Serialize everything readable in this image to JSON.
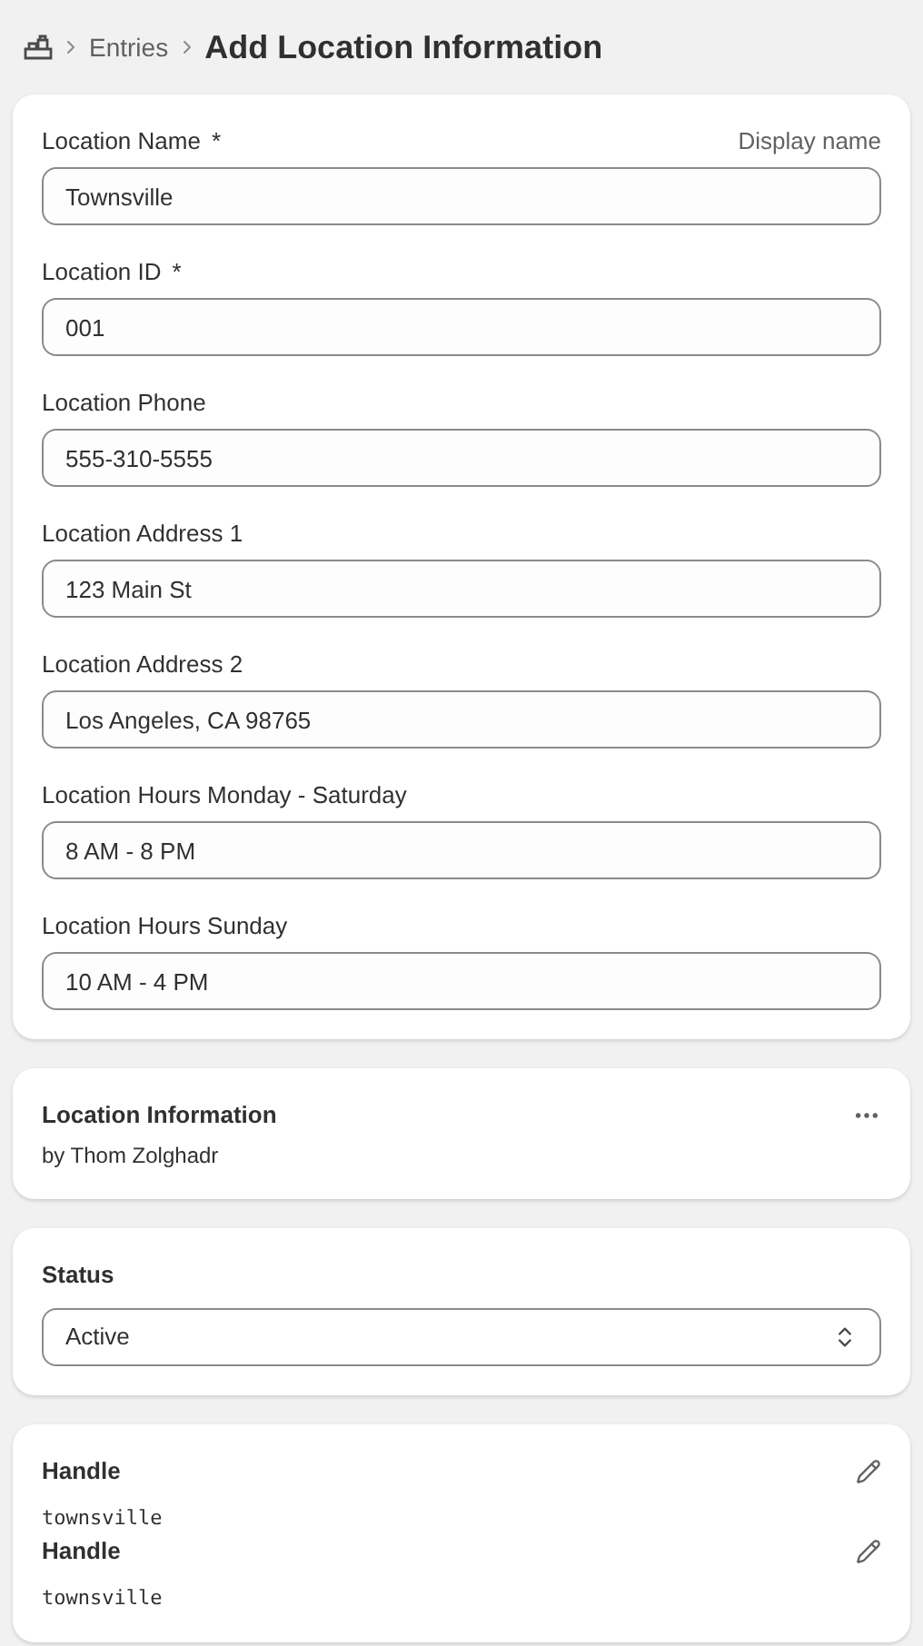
{
  "breadcrumb": {
    "items": [
      "Entries"
    ],
    "title": "Add Location Information"
  },
  "fields": [
    {
      "label": "Location Name",
      "required_mark": "*",
      "hint": "Display name",
      "value": "Townsville"
    },
    {
      "label": "Location ID",
      "required_mark": "*",
      "value": "001"
    },
    {
      "label": "Location Phone",
      "value": "555-310-5555"
    },
    {
      "label": "Location Address 1",
      "value": "123 Main St"
    },
    {
      "label": "Location Address 2",
      "value": "Los Angeles, CA 98765"
    },
    {
      "label": "Location Hours Monday - Saturday",
      "value": "8 AM - 8 PM"
    },
    {
      "label": "Location Hours Sunday",
      "value": "10 AM - 4 PM"
    }
  ],
  "definition": {
    "title": "Location Information",
    "author": "by Thom Zolghadr"
  },
  "status": {
    "label": "Status",
    "value": "Active"
  },
  "handles": [
    {
      "label": "Handle",
      "value": "townsville"
    },
    {
      "label": "Handle",
      "value": "townsville"
    }
  ]
}
